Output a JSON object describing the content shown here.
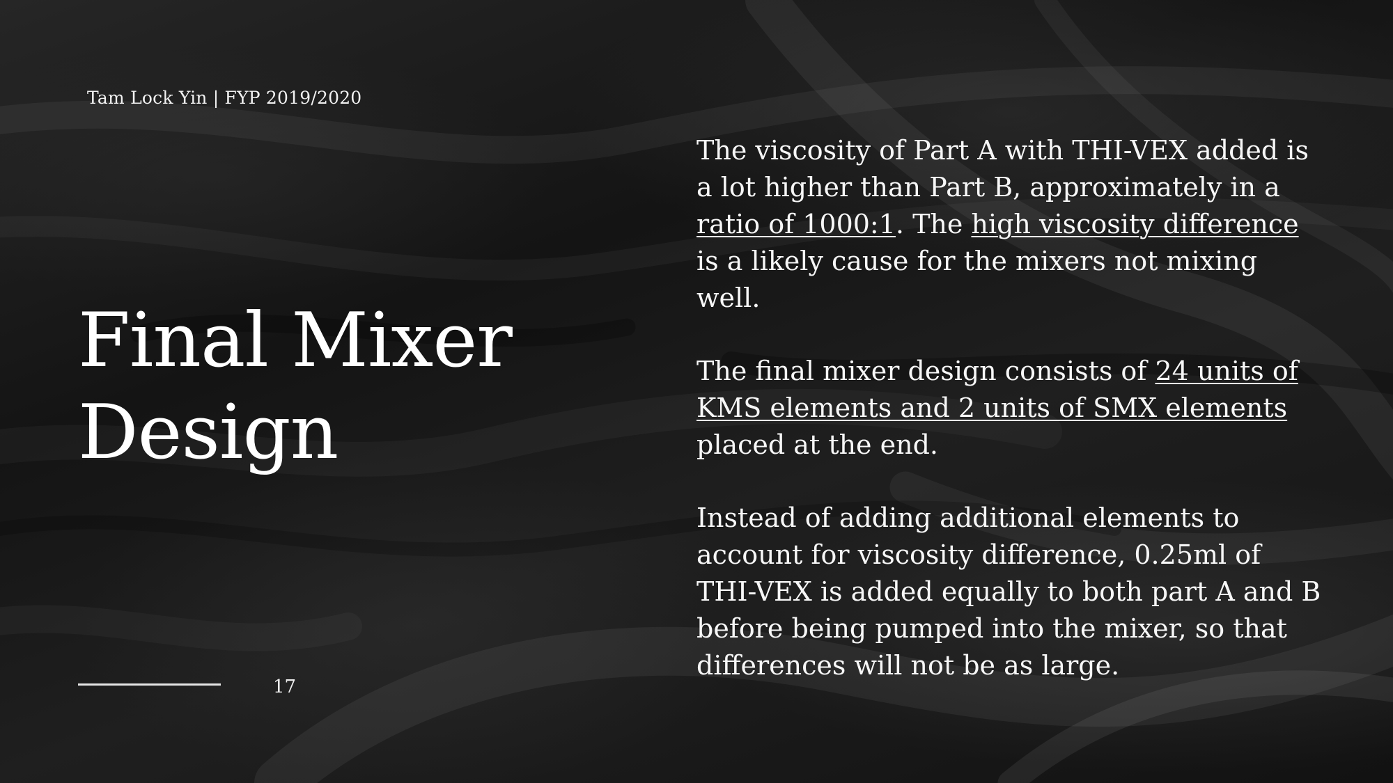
{
  "header": {
    "credit": "Tam Lock Yin | FYP 2019/2020"
  },
  "title": {
    "line1": "Final Mixer",
    "line2": "Design"
  },
  "footer": {
    "page_number": "17"
  },
  "paragraphs": {
    "p1": {
      "part1": "The viscosity of Part A with THI-VEX added is a lot higher than Part B, approximately in a ",
      "link1": "ratio of 1000:1",
      "part2": ". The ",
      "link2": "high viscosity difference",
      "part3": " is a likely cause for the mixers not mixing well."
    },
    "p2": {
      "part1": "The final mixer design consists of ",
      "link1": "24 units of KMS elements and 2 units of SMX elements",
      "part2": " placed at the end."
    },
    "p3": {
      "text": "Instead of adding additional elements to account for viscosity difference, 0.25ml of THI-VEX is added equally to both part A and B before being pumped into the mixer, so that differences will not be as large."
    }
  },
  "colors": {
    "background": "#1c1c1c",
    "text": "#ffffff"
  }
}
